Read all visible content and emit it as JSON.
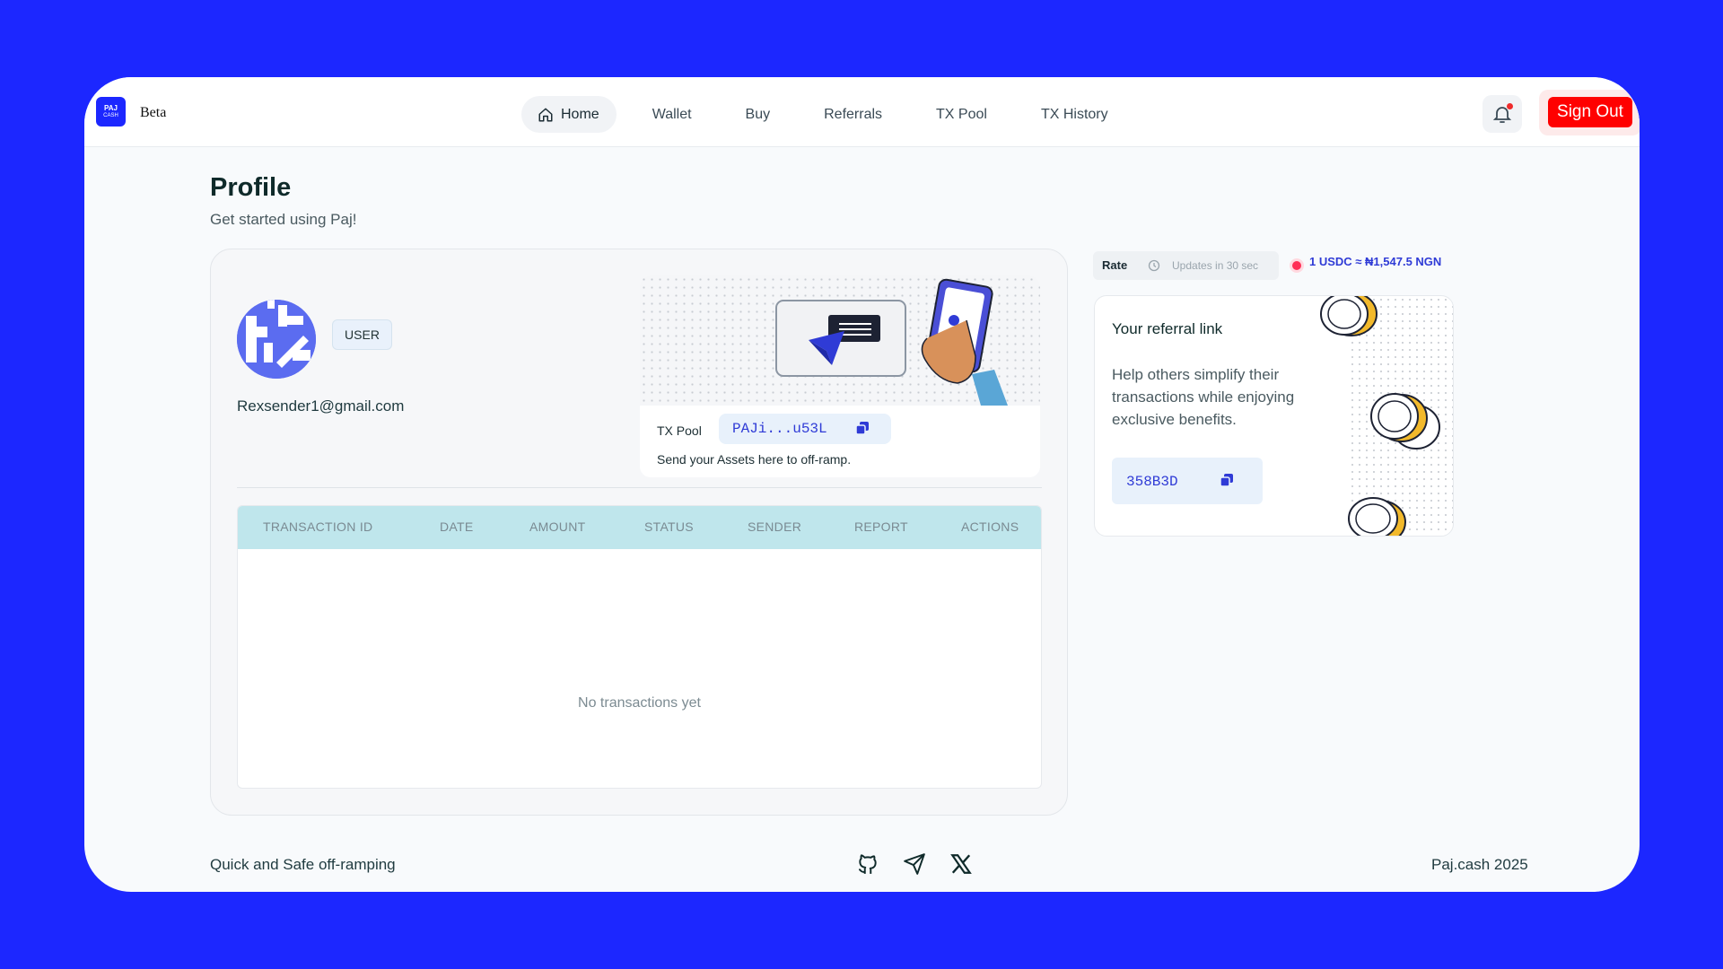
{
  "brand": {
    "logo_line1": "PAJ",
    "logo_line2": "CASH",
    "tag": "Beta"
  },
  "nav": {
    "items": [
      {
        "label": "Home",
        "active": true
      },
      {
        "label": "Wallet"
      },
      {
        "label": "Buy"
      },
      {
        "label": "Referrals"
      },
      {
        "label": "TX Pool"
      },
      {
        "label": "TX History"
      }
    ],
    "sign_out": "Sign Out"
  },
  "header": {
    "title": "Profile",
    "subtitle": "Get started using Paj!"
  },
  "profile": {
    "role": "USER",
    "email": "Rexsender1@gmail.com"
  },
  "pool": {
    "label": "TX Pool",
    "address": "PAJi...u53L",
    "note": "Send your Assets here to off-ramp."
  },
  "table": {
    "columns": [
      "TRANSACTION ID",
      "DATE",
      "AMOUNT",
      "STATUS",
      "SENDER",
      "REPORT",
      "ACTIONS"
    ],
    "empty_text": "No transactions yet"
  },
  "rate": {
    "label": "Rate",
    "updates": "Updates in 30 sec",
    "value": "1 USDC ≈ ₦1,547.5 NGN"
  },
  "referral": {
    "title": "Your referral link",
    "description": "Help others simplify their transactions while enjoying exclusive benefits.",
    "code": "358B3D"
  },
  "footer": {
    "tagline": "Quick and Safe off-ramping",
    "icons": [
      "github-icon",
      "telegram-icon",
      "x-icon"
    ],
    "copyright": "Paj.cash 2025"
  },
  "colors": {
    "brand": "#1c27ff",
    "danger": "#ff0000",
    "accent_text": "#2f3bd6",
    "table_header": "#bfe6ec"
  }
}
